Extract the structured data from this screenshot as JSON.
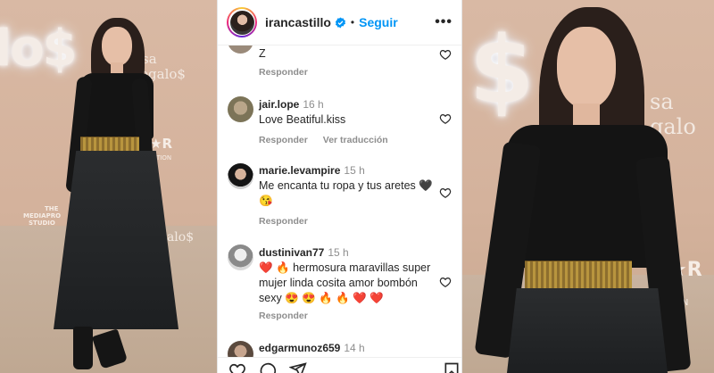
{
  "post": {
    "username": "irancastillo",
    "follow_label": "Seguir",
    "separator": "•",
    "more_label": "•••"
  },
  "comments": [
    {
      "text": "Z",
      "reply_label": "Responder"
    },
    {
      "user": "jair.lope",
      "time": "16 h",
      "text": "Love Beatiful.kiss",
      "reply_label": "Responder",
      "translate_label": "Ver traducción"
    },
    {
      "user": "marie.levampire",
      "time": "15 h",
      "text": "Me encanta tu ropa y tus aretes 🖤 😘",
      "reply_label": "Responder"
    },
    {
      "user": "dustinivan77",
      "time": "15 h",
      "text": "❤️ 🔥 hermosura maravillas super mujer linda cosita amor bombón sexy 😍 😍 🔥 🔥 ❤️ ❤️",
      "reply_label": "Responder"
    },
    {
      "user": "edgarmunoz659",
      "time": "14 h"
    }
  ],
  "backdrop": {
    "left_neon": "lo$",
    "left_sign": "osa\nregalo$",
    "left_studio_a": "THE",
    "left_studio_b": "MEDIAPRO",
    "left_studio_c": "STUDIO",
    "left_star": "★R",
    "left_star_sub": "TION",
    "left_bottom_sign": "galo$",
    "right_neon": "$",
    "right_sign": "sa\ngalo",
    "right_star": "★R",
    "right_star_sub": "CTION"
  },
  "colors": {
    "accent": "#0095f6",
    "heart_red": "#ed4956",
    "text_primary": "#262626",
    "text_secondary": "#8e8e8e"
  },
  "icons": [
    "verified-icon",
    "more-icon",
    "heart-icon",
    "like-icon",
    "comment-icon",
    "share-icon",
    "save-icon"
  ]
}
